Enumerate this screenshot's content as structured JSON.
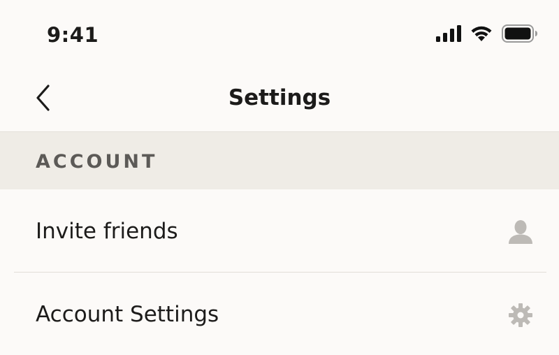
{
  "status_bar": {
    "time": "9:41",
    "signal_icon": "cellular-signal-icon",
    "wifi_icon": "wifi-icon",
    "battery_icon": "battery-icon"
  },
  "nav": {
    "back_icon": "chevron-left-icon",
    "title": "Settings"
  },
  "section": {
    "label": "ACCOUNT"
  },
  "rows": [
    {
      "label": "Invite friends",
      "icon": "person-icon"
    },
    {
      "label": "Account Settings",
      "icon": "gear-icon"
    }
  ],
  "colors": {
    "background": "#fcfaf8",
    "section_background": "#efece6",
    "text": "#1c1b1a",
    "section_text": "#5c5a57",
    "icon_gray": "#bdbab6"
  }
}
